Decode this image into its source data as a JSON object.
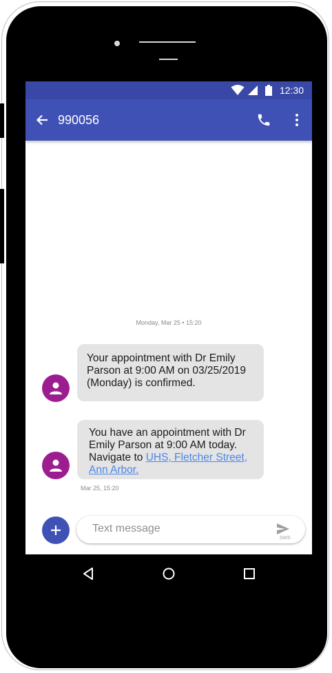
{
  "status_bar": {
    "time": "12:30",
    "icons": [
      "wifi-icon",
      "signal-icon",
      "battery-icon"
    ]
  },
  "app_bar": {
    "title": "990056",
    "back_icon": "arrow-left-icon",
    "call_icon": "phone-icon",
    "more_icon": "more-vert-icon"
  },
  "conversation": {
    "day_stamp": "Monday, Mar 25 • 15:20",
    "messages": [
      {
        "text": "Your appointment with Dr Emily Parson at 9:00 AM on 03/25/2019 (Monday) is confirmed."
      },
      {
        "text_before_link": "You have an appointment with Dr Emily Parson at 9:00 AM today. Navigate to ",
        "link_text": "UHS, Fletcher Street, Ann Arbor.",
        "time": "Mar 25, 15:20"
      }
    ]
  },
  "compose": {
    "add_icon": "plus-icon",
    "placeholder": "Text message",
    "send_icon": "send-icon",
    "send_label": "SMS"
  },
  "colors": {
    "status_bar": "#3948a6",
    "app_bar": "#3f51b5",
    "avatar": "#9c1d8f",
    "bubble": "#e4e4e4",
    "link": "#4a86e8"
  },
  "nav_bar": {
    "icons": [
      "nav-back-icon",
      "nav-home-icon",
      "nav-recents-icon"
    ]
  }
}
